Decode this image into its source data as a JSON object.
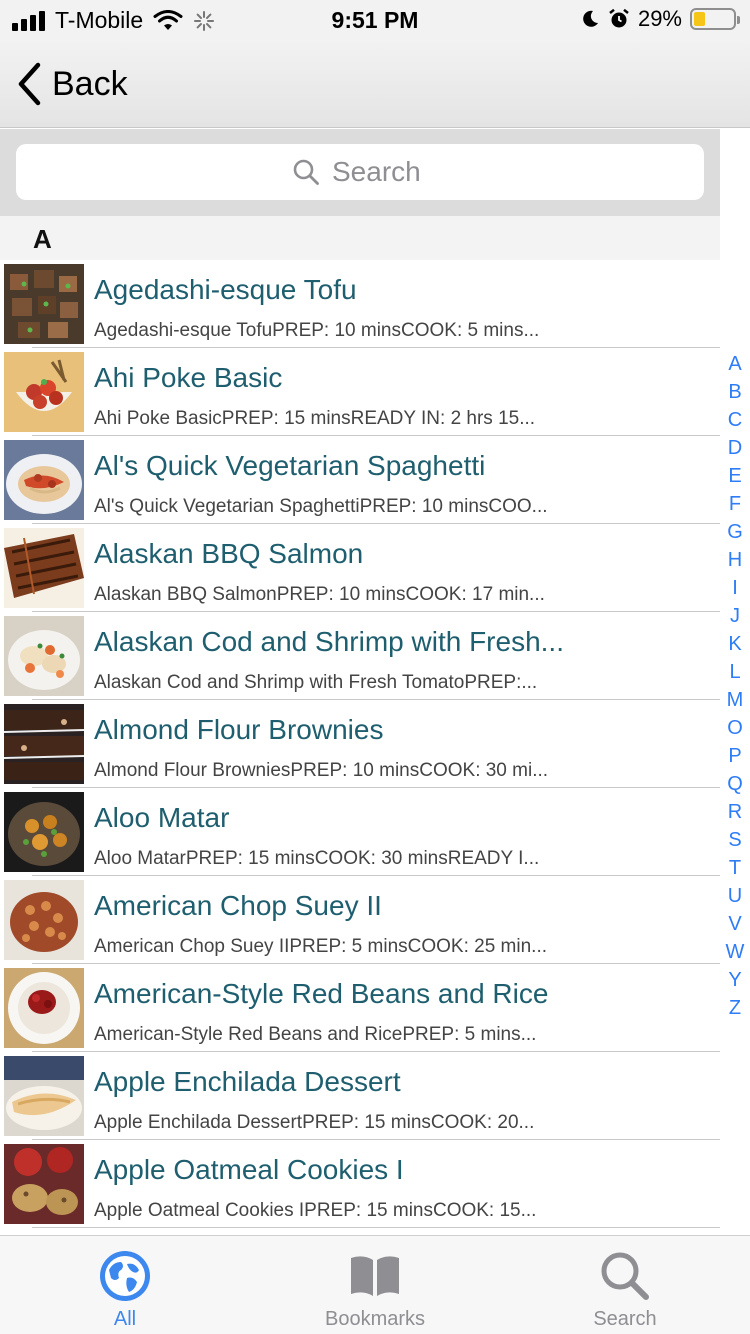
{
  "status_bar": {
    "carrier": "T-Mobile",
    "time": "9:51 PM",
    "battery_percent": "29%",
    "battery_level": 0.29,
    "icons": [
      "signal-icon",
      "wifi-icon",
      "activity-spinner-icon",
      "moon-icon",
      "alarm-icon",
      "battery-icon"
    ]
  },
  "nav": {
    "back_label": "Back",
    "icon": "chevron-left-icon"
  },
  "search": {
    "placeholder": "Search",
    "icon": "search-icon"
  },
  "section": {
    "letter": "A"
  },
  "recipes": [
    {
      "title": "Agedashi-esque Tofu",
      "subtitle": "Agedashi-esque TofuPREP: 10 minsCOOK: 5 mins..."
    },
    {
      "title": "Ahi Poke Basic",
      "subtitle": "Ahi Poke BasicPREP: 15 minsREADY IN: 2 hrs 15..."
    },
    {
      "title": "Al's Quick Vegetarian Spaghetti",
      "subtitle": "Al's Quick Vegetarian SpaghettiPREP: 10 minsCOO..."
    },
    {
      "title": "Alaskan BBQ Salmon",
      "subtitle": "Alaskan BBQ SalmonPREP: 10 minsCOOK: 17 min..."
    },
    {
      "title": "Alaskan Cod and Shrimp with Fresh...",
      "subtitle": "Alaskan Cod and Shrimp with Fresh TomatoPREP:..."
    },
    {
      "title": "Almond Flour Brownies",
      "subtitle": "Almond Flour BrowniesPREP: 10 minsCOOK: 30 mi..."
    },
    {
      "title": "Aloo Matar",
      "subtitle": "Aloo MatarPREP: 15 minsCOOK: 30 minsREADY I..."
    },
    {
      "title": "American Chop Suey II",
      "subtitle": "American Chop Suey IIPREP: 5 minsCOOK: 25 min..."
    },
    {
      "title": "American-Style Red Beans and Rice",
      "subtitle": "American-Style Red Beans and RicePREP: 5 mins..."
    },
    {
      "title": "Apple Enchilada Dessert",
      "subtitle": "Apple Enchilada DessertPREP: 15 minsCOOK: 20..."
    },
    {
      "title": "Apple Oatmeal Cookies I",
      "subtitle": "Apple Oatmeal Cookies IPREP: 15 minsCOOK: 15..."
    }
  ],
  "index_letters": [
    "A",
    "B",
    "C",
    "D",
    "E",
    "F",
    "G",
    "H",
    "I",
    "J",
    "K",
    "L",
    "M",
    "O",
    "P",
    "Q",
    "R",
    "S",
    "T",
    "U",
    "V",
    "W",
    "Y",
    "Z"
  ],
  "tabs": [
    {
      "label": "All",
      "icon": "globe-icon",
      "active": true
    },
    {
      "label": "Bookmarks",
      "icon": "book-icon",
      "active": false
    },
    {
      "label": "Search",
      "icon": "search-icon",
      "active": false
    }
  ],
  "colors": {
    "accent": "#3c88ee",
    "title_text": "#1e5e6e",
    "index_text": "#2e7cf6",
    "battery": "#f5c518"
  }
}
